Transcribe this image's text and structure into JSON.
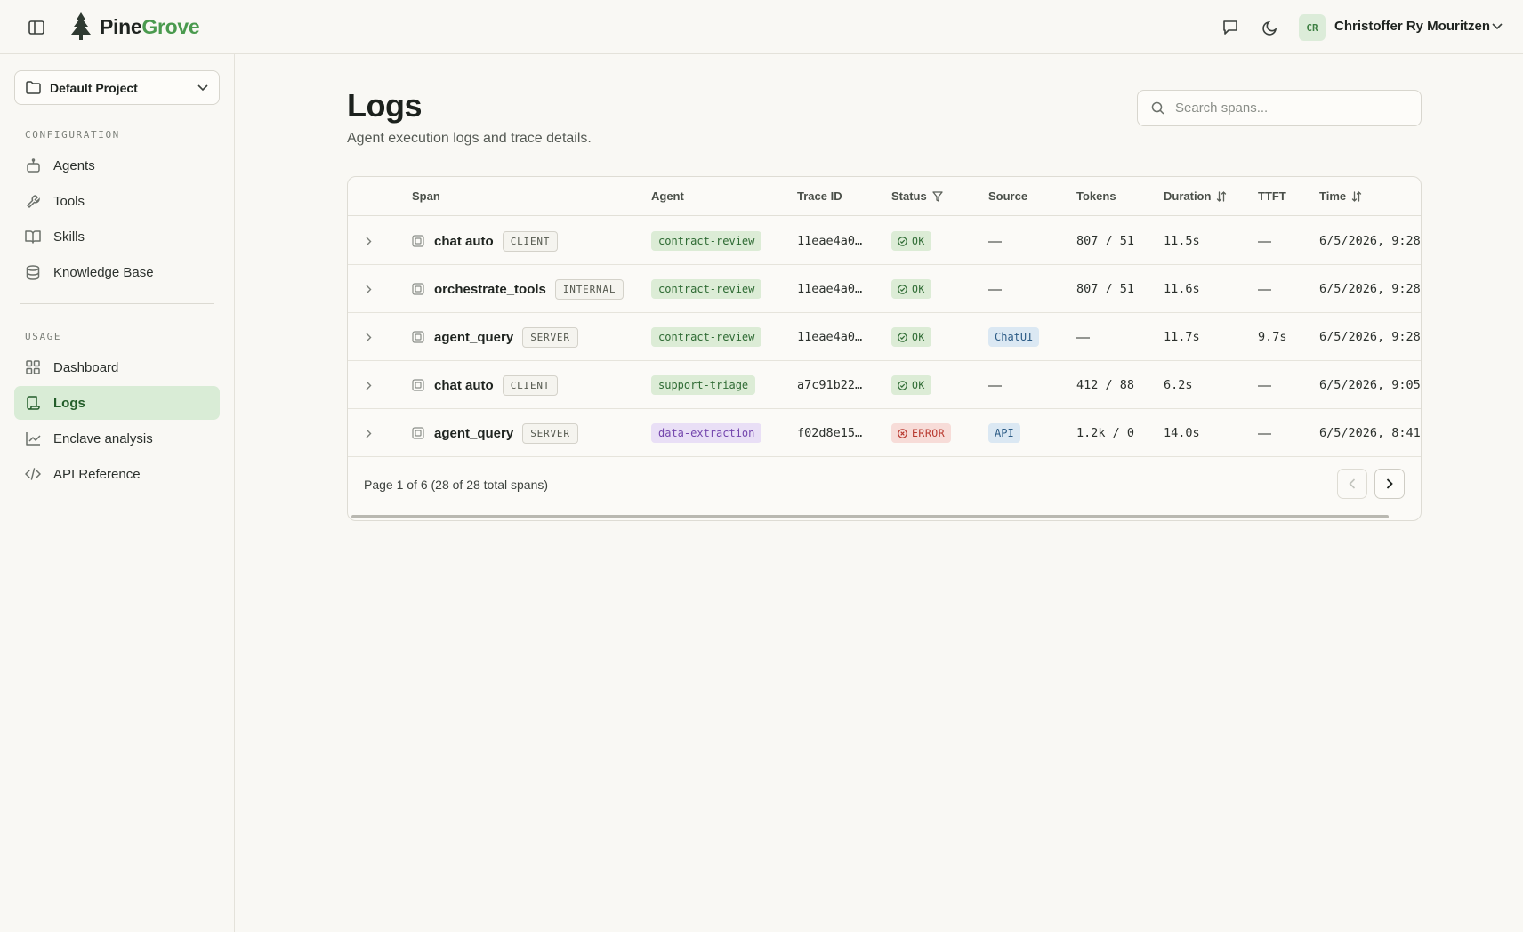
{
  "header": {
    "brand_first": "Pine",
    "brand_second": "Grove",
    "user_initials": "CR",
    "user_name": "Christoffer Ry Mouritzen",
    "accent_color": "#4a9a4e"
  },
  "sidebar": {
    "project": "Default Project",
    "sections": [
      {
        "label": "CONFIGURATION",
        "items": [
          {
            "label": "Agents",
            "icon": "robot-icon"
          },
          {
            "label": "Tools",
            "icon": "wrench-icon"
          },
          {
            "label": "Skills",
            "icon": "book-icon"
          },
          {
            "label": "Knowledge Base",
            "icon": "database-icon"
          }
        ]
      },
      {
        "label": "USAGE",
        "items": [
          {
            "label": "Dashboard",
            "icon": "dashboard-icon"
          },
          {
            "label": "Logs",
            "icon": "scroll-icon",
            "active": true
          },
          {
            "label": "Enclave analysis",
            "icon": "chart-line-icon"
          },
          {
            "label": "API Reference",
            "icon": "code-icon"
          }
        ]
      }
    ]
  },
  "main": {
    "title": "Logs",
    "subtitle": "Agent execution logs and trace details.",
    "search_placeholder": "Search spans...",
    "columns": [
      "Span",
      "Agent",
      "Trace ID",
      "Status",
      "Source",
      "Tokens",
      "Duration",
      "TTFT",
      "Time"
    ],
    "rows": [
      {
        "span": "chat auto",
        "kind": "CLIENT",
        "agent": "contract-review",
        "agent_color": "green",
        "trace": "11eae4a0…",
        "status": "OK",
        "source": "—",
        "tokens": "807 / 51",
        "duration": "11.5s",
        "ttft": "—",
        "time": "6/5/2026, 9:28"
      },
      {
        "span": "orchestrate_tools",
        "kind": "INTERNAL",
        "agent": "contract-review",
        "agent_color": "green",
        "trace": "11eae4a0…",
        "status": "OK",
        "source": "—",
        "tokens": "807 / 51",
        "duration": "11.6s",
        "ttft": "—",
        "time": "6/5/2026, 9:28"
      },
      {
        "span": "agent_query",
        "kind": "SERVER",
        "agent": "contract-review",
        "agent_color": "green",
        "trace": "11eae4a0…",
        "status": "OK",
        "source": "ChatUI",
        "tokens": "—",
        "duration": "11.7s",
        "ttft": "9.7s",
        "time": "6/5/2026, 9:28"
      },
      {
        "span": "chat auto",
        "kind": "CLIENT",
        "agent": "support-triage",
        "agent_color": "green",
        "trace": "a7c91b22…",
        "status": "OK",
        "source": "—",
        "tokens": "412 / 88",
        "duration": "6.2s",
        "ttft": "—",
        "time": "6/5/2026, 9:05"
      },
      {
        "span": "agent_query",
        "kind": "SERVER",
        "agent": "data-extraction",
        "agent_color": "purple",
        "trace": "f02d8e15…",
        "status": "ERROR",
        "source": "API",
        "tokens": "1.2k / 0",
        "duration": "14.0s",
        "ttft": "—",
        "time": "6/5/2026, 8:41"
      }
    ],
    "pagination": "Page 1 of 6 (28 of 28 total spans)"
  }
}
